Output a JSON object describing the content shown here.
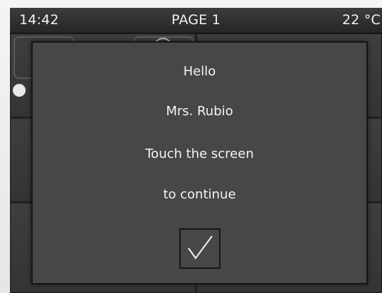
{
  "statusbar": {
    "time": "14:42",
    "page_title": "PAGE 1",
    "temperature": "22 °C"
  },
  "dialog": {
    "line1": "Hello",
    "line2": "Mrs. Rubio",
    "line3": "Touch the screen",
    "line4": "to continue",
    "confirm_icon": "checkmark-icon"
  },
  "colors": {
    "screen_background": "#2b2b2b",
    "dialog_background": "#474747",
    "text": "#f4f4f4"
  }
}
